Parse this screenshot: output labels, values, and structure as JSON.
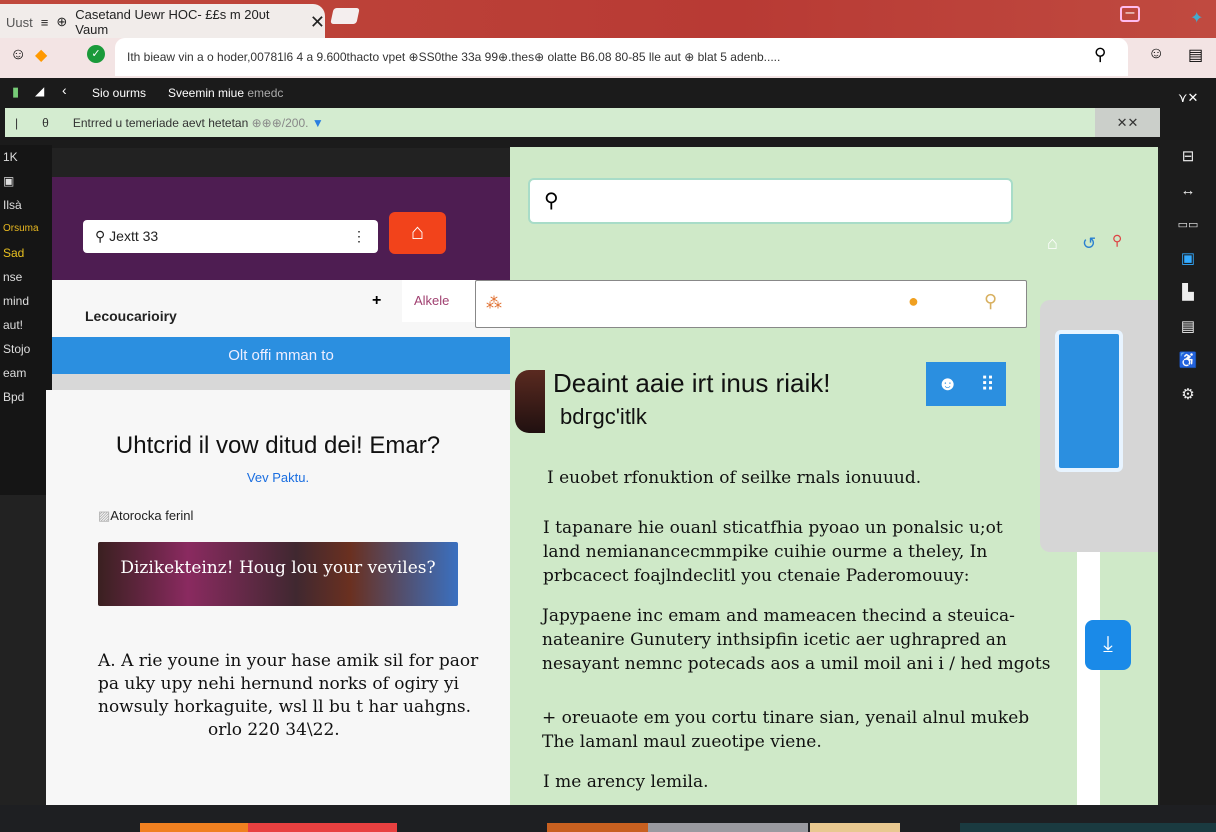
{
  "browser": {
    "tab_prefix": "Uust",
    "tab_title": "Casetand Uewr HOC- ££s m 20ᴜt Vaum",
    "url": "Ith bieaw vin a o hoder,00781l6 4 a 9.600thacto vpet ⊕SS0the 33a 99⊕.thes⊕ olatte B6.08 80-85 lle aut ⊕ blat 5 adenb....."
  },
  "toolbar": {
    "item1": "Sio ourms",
    "item2": "Sveemin miue",
    "item2_suffix": "emedc"
  },
  "notice": {
    "text": "Entrred u temeriade aevt hetetan",
    "suffix": "⊕⊕⊕/200."
  },
  "left_sidebar": {
    "items": [
      "1K",
      "Ilsà",
      "Orsuma",
      "Sad",
      "nse",
      "mind",
      "aut!",
      "Stojo",
      "eam",
      "Bpd"
    ]
  },
  "left_panel": {
    "search_value": "Jextt 33",
    "section_title": "Lecoucarioiry",
    "tab_label": "Alkele",
    "banner": "Olt offi mman to",
    "heading": "Uhtcrid il vow ditud dei! Emar?",
    "link": "Vev Paktu.",
    "caption": "Atorocka ferinl",
    "image_overlay": "Dizikekteinz! Houg lou your veviles?",
    "body": [
      "A. A rie youne in your hase amik sil for paor",
      "pa uky upy nehi hernund norks of ogiry yi",
      "nowsuly horkaguite, wsl ll bu t har uahgns."
    ],
    "footer": "orlo 220 34\\22."
  },
  "right_panel": {
    "heading": "Deaint aaie irt inus riaik!",
    "subheading": "bdгgc'itlk",
    "p1": "I euobet rfonuktion of seilke rnals ionuuud.",
    "p2": [
      "I tapanare hie ouanl sticatfhia pyoao un ponalsic u;ot",
      "land nemianancecmmpike cuihie ourme a theley, In",
      "prbcacect foajlndeclitl you ctenaie Paderomouuy:"
    ],
    "p3": [
      "Japypaene inc emam and mameacen thecind a steuica-",
      "nateanire Gunutery inthsipfin icetic aer ughrapred an",
      "nesayant nemnc potecads aos a umil moil ani i / hed mgots"
    ],
    "p4": [
      "+ oreuaote em you cortu tinare sian, yenail alnul mukeb",
      "The lamanl maul zueotipe viene."
    ],
    "p5": "I me arency lemila."
  },
  "colors": {
    "purple": "#4e1d52",
    "orange": "#f2431b",
    "blue": "#2b8fe0",
    "green": "#cfe9c8"
  }
}
